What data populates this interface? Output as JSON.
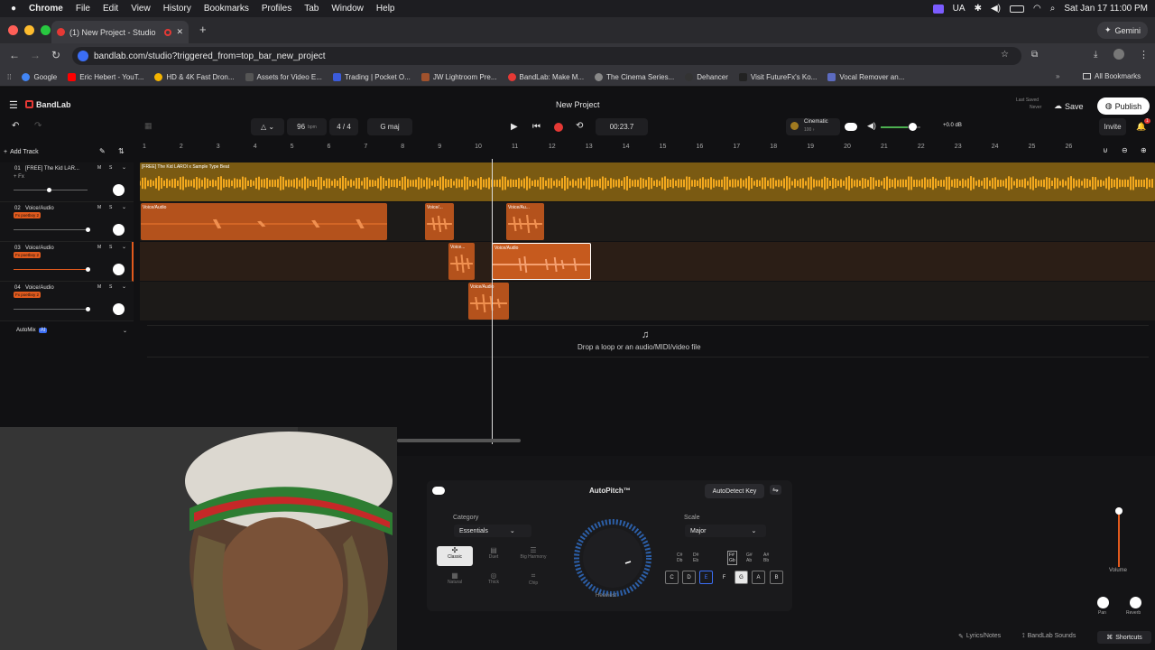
{
  "menubar": {
    "app": "Chrome",
    "items": [
      "File",
      "Edit",
      "View",
      "History",
      "Bookmarks",
      "Profiles",
      "Tab",
      "Window",
      "Help"
    ],
    "status": [
      "UA"
    ],
    "datetime": "Sat Jan 17  11:00 PM"
  },
  "browser": {
    "tab_title": "(1) New Project - Studio",
    "url": "bandlab.com/studio?triggered_from=top_bar_new_project",
    "gemini": "Gemini",
    "all_bookmarks": "All Bookmarks",
    "bookmarks": [
      {
        "label": "Google",
        "color": "#4285f4"
      },
      {
        "label": "Eric Hebert - YouT...",
        "color": "#ff0000"
      },
      {
        "label": "HD & 4K Fast Dron...",
        "color": "#f4b400"
      },
      {
        "label": "Assets for Video E...",
        "color": "#555555"
      },
      {
        "label": "Trading | Pocket O...",
        "color": "#3b5bdb"
      },
      {
        "label": "JW Lightroom Pre...",
        "color": "#a0522d"
      },
      {
        "label": "BandLab: Make M...",
        "color": "#e53935"
      },
      {
        "label": "The Cinema Series...",
        "color": "#888888"
      },
      {
        "label": "Dehancer",
        "color": "#333333"
      },
      {
        "label": "Visit FutureFx's Ko...",
        "color": "#222222"
      },
      {
        "label": "Vocal Remover an...",
        "color": "#5c6bc0"
      }
    ]
  },
  "app": {
    "brand": "BandLab",
    "project_title": "New Project",
    "last_saved_label": "Last Saved",
    "last_saved_value": "Never",
    "save": "Save",
    "publish": "Publish",
    "invite": "Invite",
    "notification_count": "1",
    "add_track": "Add Track",
    "tempo": "96",
    "tempo_unit": "bpm",
    "time_signature": "4 / 4",
    "key": "G maj",
    "timer": "00:23.7",
    "preset_name": "Cinematic",
    "preset_sub": "100 ›",
    "master_db": "+0.0 dB",
    "drop_hint": "Drop a loop or an audio/MIDI/video file",
    "automix": "AutoMix",
    "automix_badge": "AI",
    "ruler": [
      "1",
      "2",
      "3",
      "4",
      "5",
      "6",
      "7",
      "8",
      "9",
      "10",
      "11",
      "12",
      "13",
      "14",
      "15",
      "16",
      "17",
      "18",
      "19",
      "20",
      "21",
      "22",
      "23",
      "24",
      "25",
      "26"
    ],
    "lyrics_notes": "Lyrics/Notes",
    "bandlab_sounds": "BandLab Sounds",
    "shortcuts": "Shortcuts",
    "volume": "Volume",
    "pan": "Pan",
    "reverb": "Reverb"
  },
  "tracks": [
    {
      "num": "01",
      "name": "[FREE] The Kid LAR...",
      "fx": "+ Fx",
      "clip_label": "[FREE] The Kid LAROI x Sample Type Beat",
      "m": "M",
      "s": "S"
    },
    {
      "num": "02",
      "name": "Voice/Audio",
      "fx": "Fx poetboy 2",
      "clips": [
        "Voice/Audio",
        "Voice/...",
        "Voice/Au..."
      ],
      "m": "M",
      "s": "S"
    },
    {
      "num": "03",
      "name": "Voice/Audio",
      "fx": "Fx poetboy 2",
      "clips": [
        "Voice...",
        "Voice/Audio"
      ],
      "m": "M",
      "s": "S"
    },
    {
      "num": "04",
      "name": "Voice/Audio",
      "fx": "Fx poetboy 2",
      "clips": [
        "Voice/Audio"
      ],
      "m": "M",
      "s": "S"
    }
  ],
  "autopitch": {
    "title": "AutoPitch™",
    "autodetect": "AutoDetect Key",
    "category_label": "Category",
    "category_value": "Essentials",
    "scale_label": "Scale",
    "scale_value": "Major",
    "knob_label": "Heaviest",
    "modes": [
      "Classic",
      "Duet",
      "Big Harmony",
      "Natural",
      "Thick",
      "Chip"
    ],
    "sharps": [
      "C#\nDb",
      "D#\nEb",
      "F#\nGb",
      "G#\nAb",
      "A#\nBb"
    ],
    "keys": [
      "C",
      "D",
      "E",
      "F",
      "G",
      "A",
      "B"
    ]
  }
}
